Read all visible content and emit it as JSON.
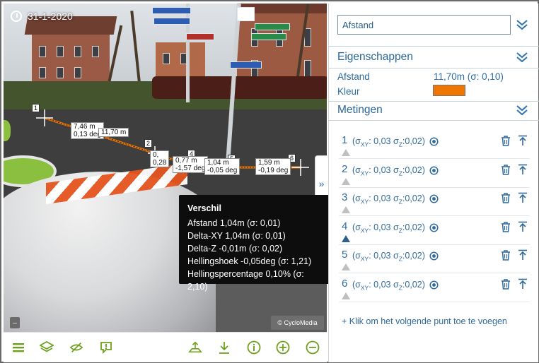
{
  "viewer": {
    "date": "31-1-2020",
    "copyright": "© CycloMedia",
    "minimize_label": "_",
    "collapse_label": "»"
  },
  "measure_labels": {
    "p1": "1",
    "p2": "2",
    "p3": "3",
    "p4": "4",
    "p5": "5",
    "p6": "6",
    "seg12": "7,46 m\n0,13 deg",
    "total": "11,70 m",
    "seg34": "0,77 m\n-1,57 deg",
    "seg45": "1,04 m\n-0,05 deg",
    "seg56": "1,59 m\n-0,19 deg",
    "seg23": "0,\n0,28"
  },
  "tooltip": {
    "title": "Verschil",
    "lines": [
      "Afstand 1,04m (σ: 0,01)",
      "Delta-XY 1,04m (σ: 0,01)",
      "Delta-Z -0,01m (σ: 0,02)",
      "Hellingshoek -0,05deg (σ: 1,21)",
      "Hellingspercentage 0,10% (σ: 2,10)"
    ]
  },
  "toolbar": {
    "icons": [
      "menu-icon",
      "layers-icon",
      "hide-icon",
      "comment-icon",
      "export-icon",
      "download-icon",
      "info-icon",
      "zoom-in-icon",
      "zoom-out-icon"
    ]
  },
  "panel": {
    "search_value": "Afstand",
    "properties_title": "Eigenschappen",
    "distance_label": "Afstand",
    "distance_value": "11,70m (σ: 0,10)",
    "color_label": "Kleur",
    "color_value": "#ee7600",
    "measurements_title": "Metingen",
    "rows": [
      {
        "num": "1",
        "sxy": "0,03",
        "sz": "0,02",
        "active": false
      },
      {
        "num": "2",
        "sxy": "0,03",
        "sz": "0,02",
        "active": false
      },
      {
        "num": "3",
        "sxy": "0,03",
        "sz": "0,02",
        "active": false
      },
      {
        "num": "4",
        "sxy": "0,03",
        "sz": "0,02",
        "active": true
      },
      {
        "num": "5",
        "sxy": "0,03",
        "sz": "0,02",
        "active": false
      },
      {
        "num": "6",
        "sxy": "0,03",
        "sz": "0,02",
        "active": false
      }
    ],
    "sigma_prefix": "(σ",
    "sigma_xy_sub": "XY",
    "sigma_z": " σ",
    "sigma_z_sub": "Z",
    "add_point_label": "+ Klik om het volgende punt toe te voegen"
  },
  "colors": {
    "accent": "#2f6a9a",
    "toolbar_green": "#6da11d",
    "measure_line": "#ee7600"
  }
}
